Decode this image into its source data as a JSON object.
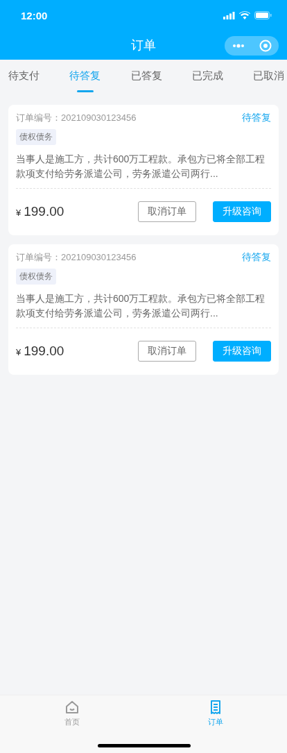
{
  "status_bar": {
    "time": "12:00"
  },
  "nav": {
    "title": "订单"
  },
  "tabs": [
    {
      "label": "待支付",
      "selected": false
    },
    {
      "label": "待答复",
      "selected": true
    },
    {
      "label": "已答复",
      "selected": false
    },
    {
      "label": "已完成",
      "selected": false
    },
    {
      "label": "已取消",
      "selected": false
    }
  ],
  "orders": [
    {
      "order_no": "订单编号：202109030123456",
      "status": "待答复",
      "tag": "债权债务",
      "description": "当事人是施工方，共计600万工程款。承包方已将全部工程款项支付给劳务派遣公司，劳务派遣公司两行...",
      "currency": "¥",
      "price": "199.00",
      "buttons": [
        "取消订单",
        "升级咨询"
      ]
    },
    {
      "order_no": "订单编号：202109030123456",
      "status": "待答复",
      "tag": "债权债务",
      "description": "当事人是施工方，共计600万工程款。承包方已将全部工程款项支付给劳务派遣公司，劳务派遣公司两行...",
      "currency": "¥",
      "price": "199.00",
      "buttons": [
        "取消订单",
        "升级咨询"
      ]
    }
  ],
  "tab_bar": [
    {
      "label": "首页",
      "kind": "home",
      "selected": false
    },
    {
      "label": "订单",
      "kind": "orders",
      "selected": true
    }
  ]
}
